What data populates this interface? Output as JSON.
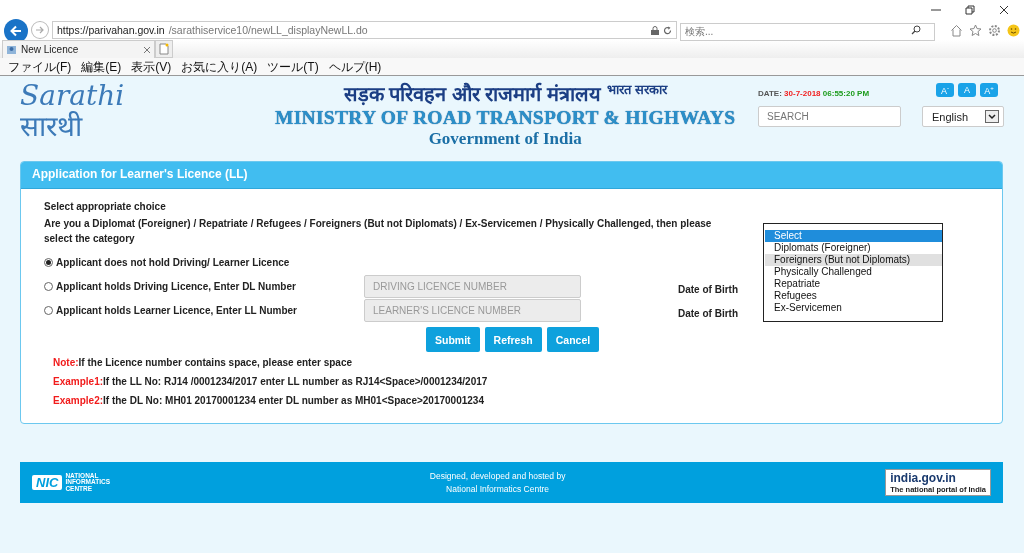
{
  "browser": {
    "address": {
      "host": "https://parivahan.gov.in",
      "path": "/sarathiservice10/newLL_displayNewLL.do"
    },
    "search": {
      "placeholder": "検索..."
    },
    "tabs": [
      {
        "label": "New Licence"
      }
    ],
    "menu": [
      "ファイル(F)",
      "編集(E)",
      "表示(V)",
      "お気に入り(A)",
      "ツール(T)",
      "ヘルプ(H)"
    ]
  },
  "header": {
    "logo": {
      "latin": "Sarathi",
      "hindi": "सारथी"
    },
    "ministry_hindi": "सड़क परिवहन और राजमार्ग मंत्रालय",
    "government_hindi": "भारत सरकार",
    "ministry": "MINISTRY OF ROAD TRANSPORT & HIGHWAYS",
    "government": "Government of India",
    "date_label": "DATE:",
    "date": "30-7-2018",
    "time": "06:55:20 PM",
    "font_buttons": [
      "A$^{-}$",
      "A",
      "A$^{+}$"
    ],
    "search": {
      "placeholder": "SEARCH"
    },
    "language": "English"
  },
  "panel": {
    "title": "Application for Learner's Licence (LL)",
    "intro": "Select appropriate choice",
    "question": "Are you a Diplomat (Foreigner) / Repatriate / Refugees / Foreigners (But not Diplomats) / Ex-Servicemen / Physically Challenged, then please select the category",
    "category_list": [
      {
        "label": "Select",
        "selected": true,
        "hovered": false
      },
      {
        "label": "Diplomats (Foreigner)",
        "selected": false,
        "hovered": false
      },
      {
        "label": "Foreigners (But not Diplomats)",
        "selected": false,
        "hovered": true
      },
      {
        "label": "Physically Challenged",
        "selected": false,
        "hovered": false
      },
      {
        "label": "Repatriate",
        "selected": false,
        "hovered": false
      },
      {
        "label": "Refugees",
        "selected": false,
        "hovered": false
      },
      {
        "label": "Ex-Servicemen",
        "selected": false,
        "hovered": false
      }
    ],
    "options": [
      {
        "label": "Applicant does not hold Driving/ Learner Licence",
        "selected": true
      },
      {
        "label": "Applicant holds Driving Licence, Enter DL Number",
        "selected": false,
        "placeholder": "DRIVING LICENCE NUMBER",
        "dob_label": "Date of Birth"
      },
      {
        "label": "Applicant holds Learner Licence, Enter LL Number",
        "selected": false,
        "placeholder": "LEARNER'S LICENCE NUMBER",
        "dob_label": "Date of Birth"
      }
    ],
    "buttons": [
      "Submit",
      "Refresh",
      "Cancel"
    ],
    "notes": [
      {
        "label": "Note:",
        "text": "If the Licence number contains space, please enter space"
      },
      {
        "label": "Example1:",
        "text": "If the LL No: RJ14 /0001234/2017 enter LL number as RJ14<Space>/0001234/2017"
      },
      {
        "label": "Example2:",
        "text": "If the DL No: MH01 20170001234 enter DL number as MH01<Space>20170001234"
      }
    ]
  },
  "footer": {
    "nic": {
      "mark": "NIC",
      "name": [
        "NATIONAL",
        "INFORMATICS",
        "CENTRE"
      ]
    },
    "credit": [
      "Designed, developed and hosted by",
      "National Informatics Centre"
    ],
    "portal": {
      "name": "india.gov.in",
      "tagline": "The national portal of India"
    }
  }
}
